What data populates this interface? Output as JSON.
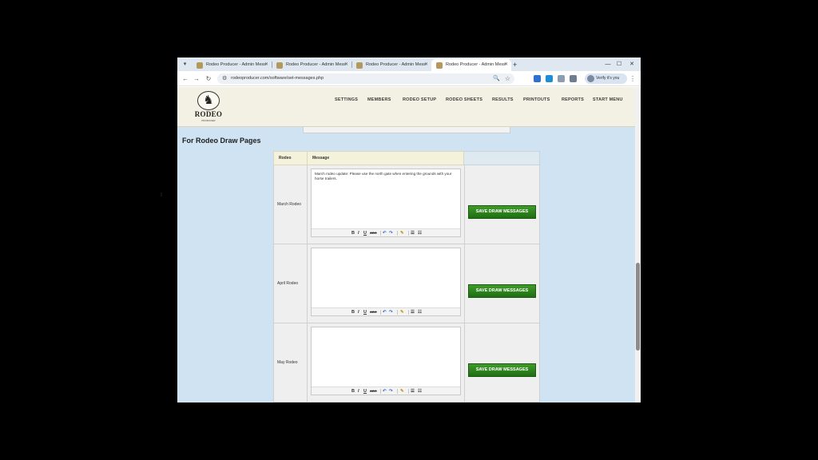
{
  "browser": {
    "tabs": [
      {
        "title": "Rodeo Producer - Admin Mess"
      },
      {
        "title": "Rodeo Producer - Admin Mess"
      },
      {
        "title": "Rodeo Producer - Admin Mess"
      },
      {
        "title": "Rodeo Producer - Admin Mess",
        "active": true
      }
    ],
    "url": "rodeoproducer.com/software/set-messages.php",
    "profile_label": "Verify it's you"
  },
  "header": {
    "logo_text": "RODEO",
    "logo_subtext": "PRODUCER",
    "menu": [
      "SETTINGS",
      "MEMBERS",
      "RODEO SETUP",
      "RODEO SHEETS",
      "RESULTS",
      "PRINTOUTS",
      "REPORTS",
      "START MENU"
    ]
  },
  "section": {
    "title": "For Rodeo Draw Pages",
    "col_rodeo": "Rodeo",
    "col_message": "Message"
  },
  "rows": [
    {
      "rodeo": "March Rodeo",
      "message": "March rodeo update: Please use the north gate when entering the grounds with your horse trailers.",
      "button": "SAVE DRAW MESSAGES"
    },
    {
      "rodeo": "April Rodeo",
      "message": "",
      "button": "SAVE DRAW MESSAGES"
    },
    {
      "rodeo": "May Rodeo",
      "message": "",
      "button": "SAVE DRAW MESSAGES"
    }
  ],
  "colors": {
    "page_bg": "#cfe3f2",
    "header_bg": "#f3f1e3",
    "button_green": "#2e8a1e"
  },
  "icons": [
    "horse-logo-icon",
    "bold-icon",
    "italic-icon",
    "underline-icon",
    "strikethrough-icon",
    "undo-icon",
    "redo-icon",
    "clean-icon",
    "bullet-list-icon",
    "numbered-list-icon"
  ]
}
